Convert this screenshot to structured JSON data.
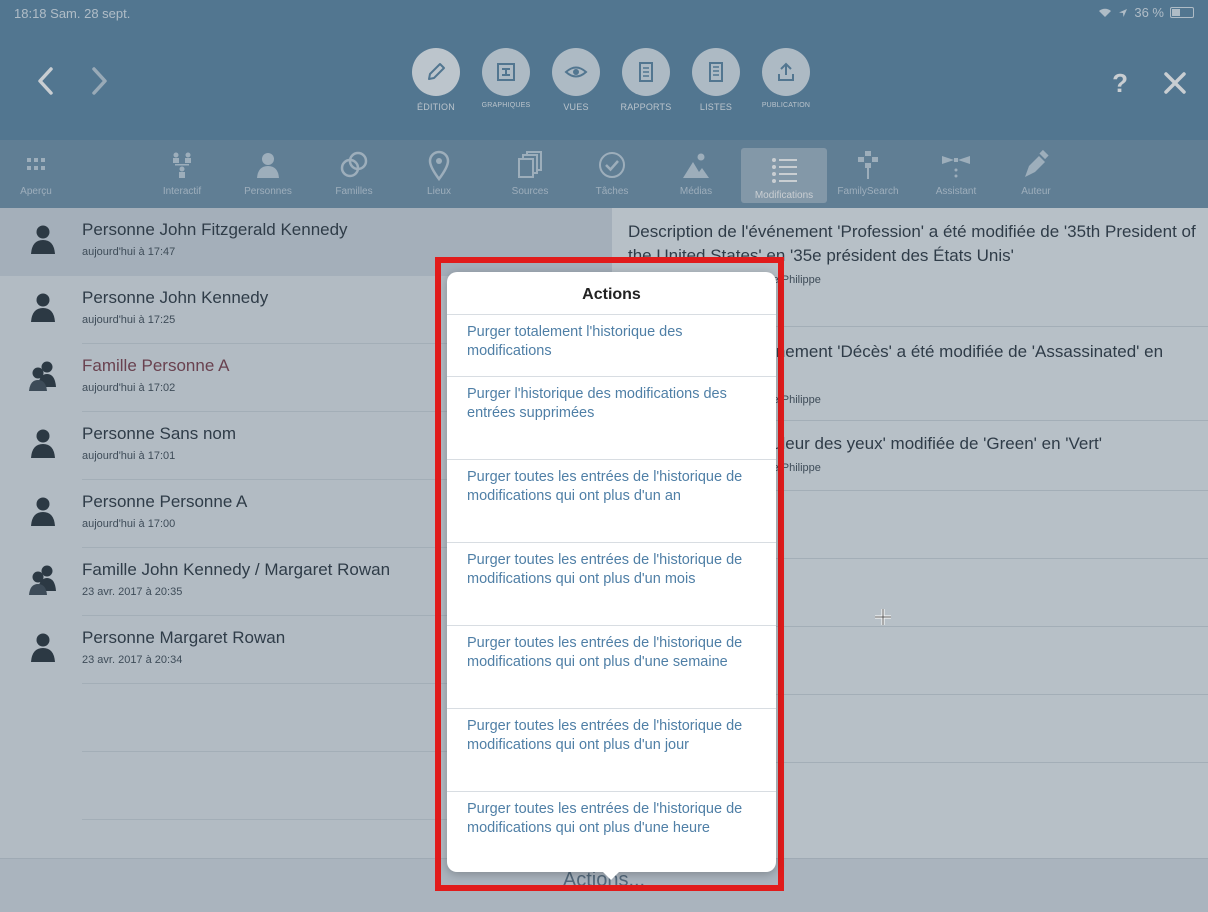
{
  "status": {
    "time": "18:18  Sam. 28 sept.",
    "battery": "36 %"
  },
  "topbar": {
    "back_icon": "chevron-left-icon",
    "forward_icon": "chevron-right-icon",
    "help": "?",
    "buttons": [
      {
        "label": "ÉDITION",
        "icon": "pencil-icon"
      },
      {
        "label": "GRAPHIQUES",
        "icon": "chart-icon"
      },
      {
        "label": "VUES",
        "icon": "eye-icon"
      },
      {
        "label": "RAPPORTS",
        "icon": "document-icon"
      },
      {
        "label": "LISTES",
        "icon": "list-document-icon"
      },
      {
        "label": "PUBLICATION",
        "icon": "upload-icon"
      }
    ]
  },
  "toolbar": {
    "items": [
      {
        "label": "Aperçu",
        "icon": "grid-icon"
      },
      {
        "label": "Interactif",
        "icon": "tree-icon"
      },
      {
        "label": "Personnes",
        "icon": "person-icon"
      },
      {
        "label": "Familles",
        "icon": "rings-icon"
      },
      {
        "label": "Lieux",
        "icon": "pin-icon"
      },
      {
        "label": "Sources",
        "icon": "sources-icon"
      },
      {
        "label": "Tâches",
        "icon": "check-icon"
      },
      {
        "label": "Médias",
        "icon": "media-icon"
      },
      {
        "label": "Modifications",
        "icon": "list-icon"
      },
      {
        "label": "FamilySearch",
        "icon": "familysearch-icon"
      },
      {
        "label": "Assistant",
        "icon": "assistant-icon"
      },
      {
        "label": "Auteur",
        "icon": "pen-icon"
      }
    ],
    "selected": "Modifications"
  },
  "list": [
    {
      "name": "Personne John Fitzgerald Kennedy",
      "date": "aujourd'hui à 17:47",
      "kind": "person"
    },
    {
      "name": "Personne John Kennedy",
      "date": "aujourd'hui à 17:25",
      "kind": "person"
    },
    {
      "name": "Famille Personne A",
      "date": "aujourd'hui à 17:02",
      "kind": "family"
    },
    {
      "name": "Personne Sans nom",
      "date": "aujourd'hui à 17:01",
      "kind": "person"
    },
    {
      "name": "Personne Personne A",
      "date": "aujourd'hui à 17:00",
      "kind": "person"
    },
    {
      "name": "Famille John Kennedy / Margaret Rowan",
      "date": "23 avr. 2017 à 20:35",
      "kind": "family"
    },
    {
      "name": "Personne Margaret Rowan",
      "date": "23 avr. 2017 à 20:34",
      "kind": "person"
    }
  ],
  "details": [
    {
      "text": "Description de l'événement 'Profession' a été modifiée de '35th President of the United States' en '35e président des États Unis'",
      "by": "aujourd'hui à 17:47 · Bonnaure Philippe"
    },
    {
      "text": "Description de l'événement 'Décès' a été modifiée de 'Assassinated' en 'Assassiné'",
      "by": "aujourd'hui à 17:46 · Bonnaure Philippe"
    },
    {
      "text": "Caractéristique 'Couleur des yeux' modifiée de 'Green' en 'Vert'",
      "by": "aujourd'hui à 17:45 · Bonnaure Philippe"
    }
  ],
  "bottom": {
    "label": "Actions..."
  },
  "popover": {
    "title": "Actions",
    "actions": [
      "Purger totalement l'historique des modifications",
      "Purger l'historique des modifications des entrées supprimées",
      "Purger toutes les entrées de l'historique de modifications qui ont plus d'un an",
      "Purger toutes les entrées de l'historique de modifications qui ont plus d'un mois",
      "Purger toutes les entrées de l'historique de modifications qui ont plus d'une semaine",
      "Purger toutes les entrées de l'historique de modifications qui ont plus d'un jour",
      "Purger toutes les entrées de l'historique de modifications qui ont plus d'une heure"
    ]
  },
  "colors": {
    "header": "#5b85a4",
    "toolbar": "#6e90aa",
    "highlight": "#e11b1b",
    "link": "#4f7fa6"
  }
}
